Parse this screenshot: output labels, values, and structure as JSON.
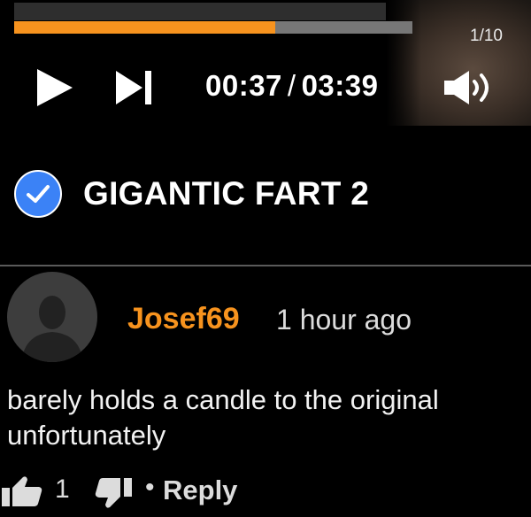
{
  "player": {
    "progress_fraction": 0.655,
    "image_counter": "1/10",
    "current_time": "00:37",
    "time_separator": "/",
    "duration": "03:39",
    "accent_color": "#f7931e",
    "icons": [
      "play-icon",
      "skip-next-icon",
      "volume-icon"
    ]
  },
  "video": {
    "title": "GIGANTIC FART 2",
    "verified_icon": "verified-check-icon"
  },
  "comment": {
    "username": "Josef69",
    "time_ago": "1 hour ago",
    "text": "barely holds a candle to the original unfortunately",
    "likes": "1",
    "bullet": "•",
    "reply_label": "Reply"
  }
}
